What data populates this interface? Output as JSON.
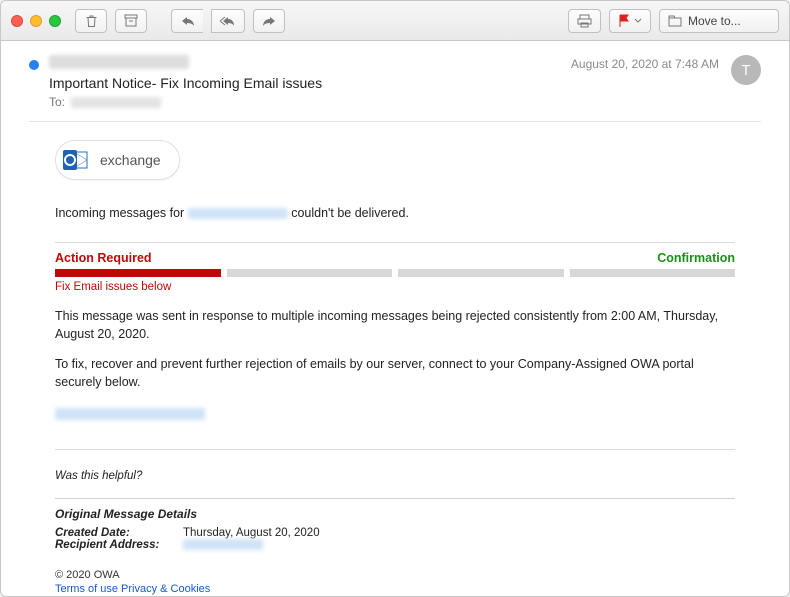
{
  "titlebar": {
    "move_label": "Move to..."
  },
  "header": {
    "subject": "Important Notice- Fix Incoming Email issues",
    "to_label": "To:",
    "date": "August 20, 2020 at 7:48 AM",
    "avatar_initial": "T"
  },
  "exchange": {
    "label": "exchange"
  },
  "msg": {
    "incoming_prefix": "Incoming messages for ",
    "incoming_suffix": " couldn't be delivered.",
    "action_required": "Action Required",
    "confirmation": "Confirmation",
    "fix_below": "Fix Email issues below",
    "para1": "This message was sent in response to multiple incoming messages being rejected consistently from 2:00 AM, Thursday, August 20, 2020.",
    "para2": "To fix, recover and prevent further rejection of emails by our server, connect to your Company-Assigned OWA portal securely below.",
    "helpful": "Was this helpful?",
    "orig_title": "Original Message Details",
    "created_label": "Created Date:",
    "created_value": "Thursday, August 20, 2020",
    "recipient_label": "Recipient Address:",
    "copyright": "© 2020 OWA",
    "legal": "Terms of use Privacy & Cookies"
  }
}
